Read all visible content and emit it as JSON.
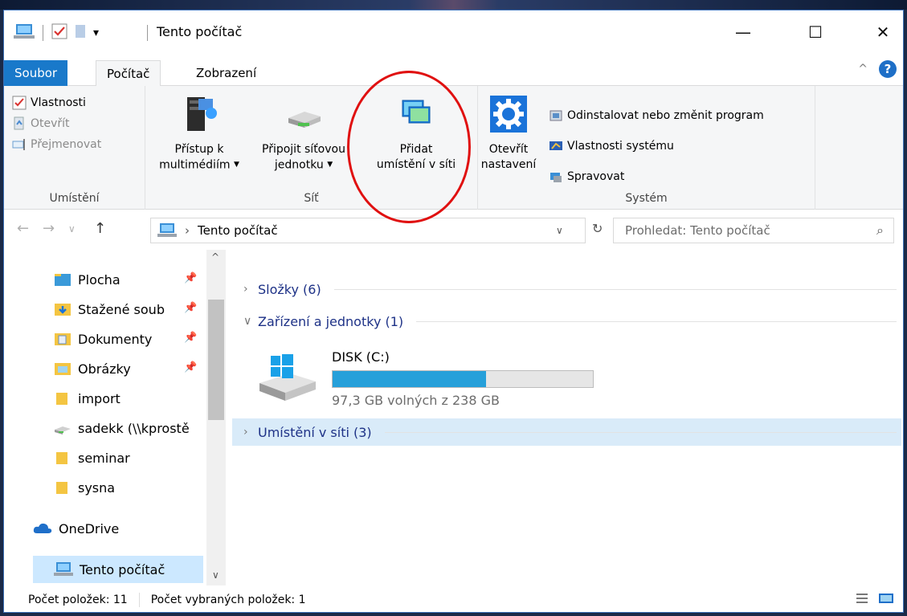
{
  "window": {
    "title": "Tento počítač",
    "controls": {
      "minimize": "—",
      "maximize": "☐",
      "close": "✕"
    }
  },
  "ribbon_tabs": [
    {
      "label": "Soubor"
    },
    {
      "label": "Počítač"
    },
    {
      "label": "Zobrazení"
    }
  ],
  "ribbon": {
    "location_group": {
      "label": "Umístění",
      "items": [
        "Vlastnosti",
        "Otevřít",
        "Přejmenovat"
      ]
    },
    "network_group": {
      "label": "Síť",
      "media": {
        "line1": "Přístup k",
        "line2": "multimédiím"
      },
      "map_drive": {
        "line1": "Připojit síťovou",
        "line2": "jednotku"
      },
      "add_location": {
        "line1": "Přidat",
        "line2": "umístění v síti"
      }
    },
    "settings": {
      "line1": "Otevřít",
      "line2": "nastavení"
    },
    "system_group": {
      "label": "Systém",
      "items": [
        "Odinstalovat nebo změnit program",
        "Vlastnosti systému",
        "Spravovat"
      ]
    }
  },
  "address": {
    "path": "Tento počítač",
    "search_placeholder": "Prohledat: Tento počítač"
  },
  "nav": {
    "items": [
      {
        "label": "Plocha",
        "pinned": true
      },
      {
        "label": "Stažené soub",
        "pinned": true
      },
      {
        "label": "Dokumenty",
        "pinned": true
      },
      {
        "label": "Obrázky",
        "pinned": true
      },
      {
        "label": "import"
      },
      {
        "label": "sadekk (\\\\kprostě"
      },
      {
        "label": "seminar"
      },
      {
        "label": "sysna"
      },
      {
        "label": "OneDrive"
      },
      {
        "label": "Tento počítač"
      }
    ]
  },
  "content": {
    "sections": [
      {
        "label": "Složky (6)"
      },
      {
        "label": "Zařízení a jednotky (1)"
      },
      {
        "label": "Umístění v síti (3)"
      }
    ],
    "drive": {
      "name": "DISK (C:)",
      "free_text": "97,3 GB volných z 238 GB",
      "used_fraction": 0.59
    }
  },
  "status": {
    "items_count": "Počet položek: 11",
    "selected_count": "Počet vybraných položek: 1"
  },
  "colors": {
    "accent": "#1979ca",
    "selection": "#cce8ff",
    "drive_fill": "#26a0da",
    "annotation": "#e01010"
  }
}
